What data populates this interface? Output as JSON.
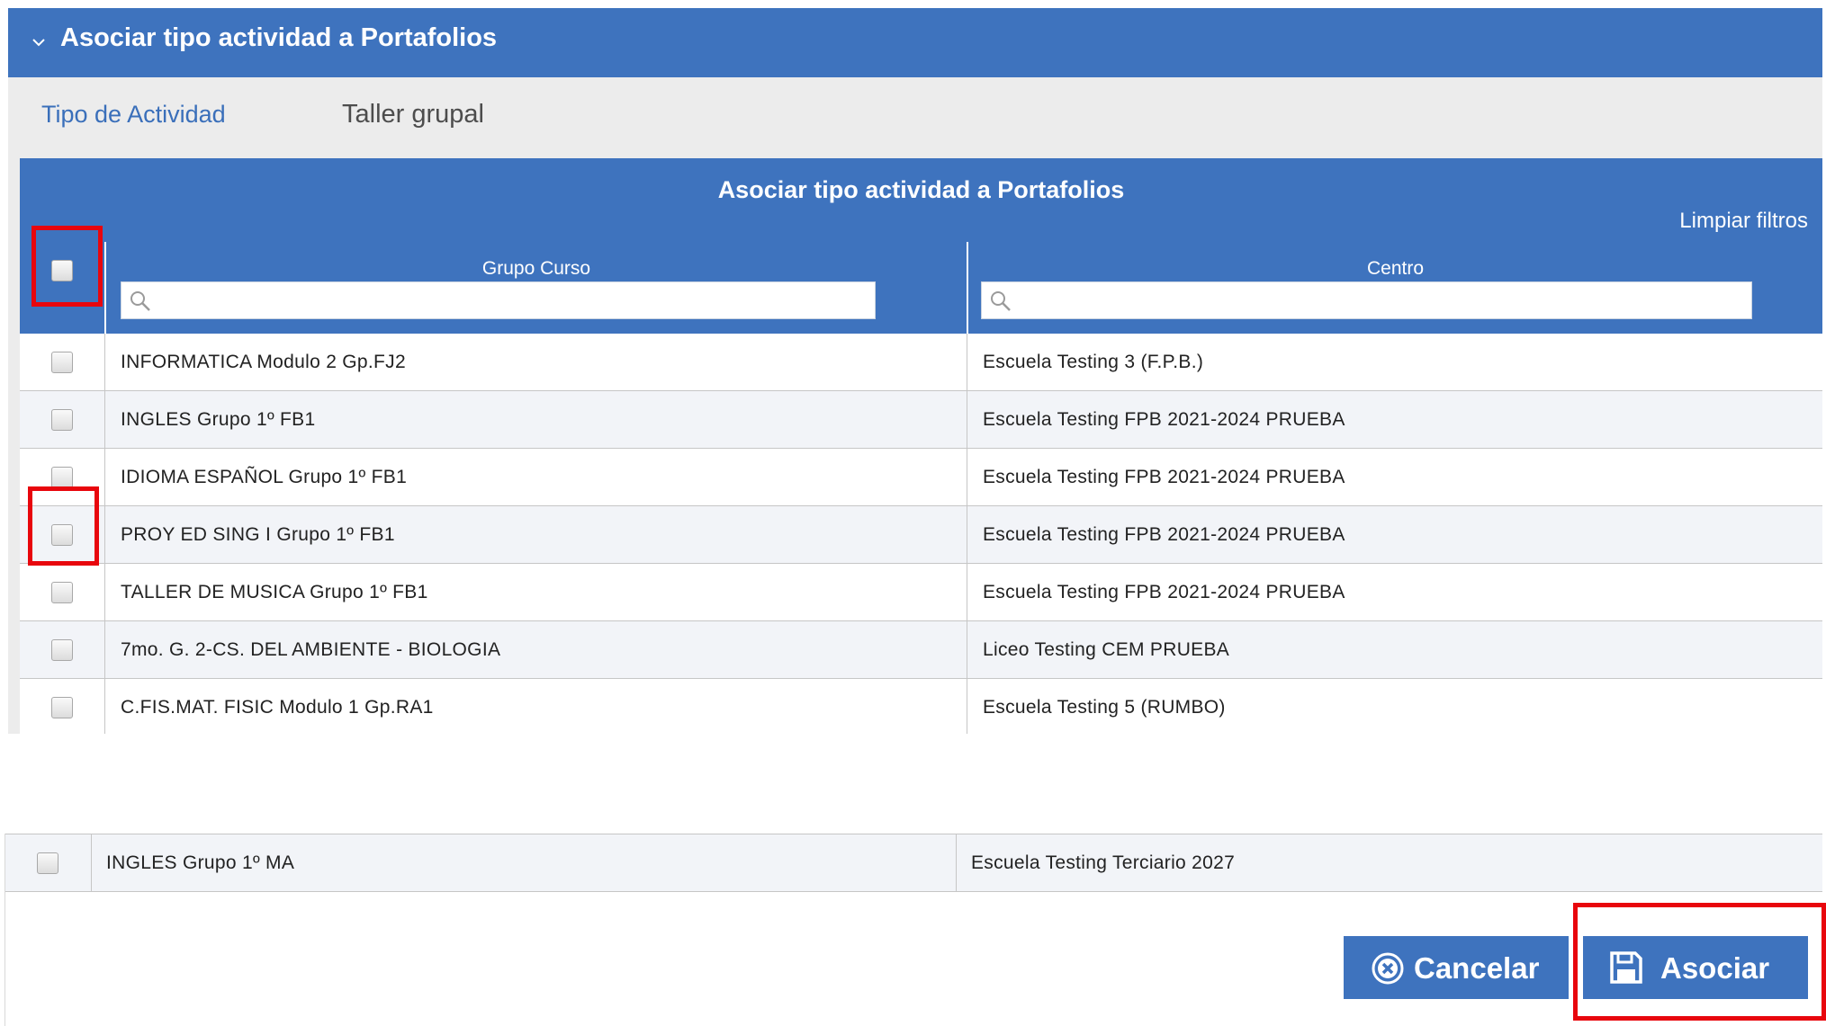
{
  "section": {
    "title": "Asociar tipo actividad a Portafolios"
  },
  "activity": {
    "label": "Tipo de Actividad",
    "value": "Taller grupal"
  },
  "grid": {
    "caption": "Asociar tipo actividad a Portafolios",
    "clear_filters": "Limpiar filtros",
    "columns": {
      "group": "Grupo Curso",
      "center": "Centro"
    },
    "rows": [
      {
        "group": "INFORMATICA Modulo 2 Gp.FJ2",
        "center": "Escuela Testing 3 (F.P.B.)"
      },
      {
        "group": "INGLES Grupo 1º FB1",
        "center": "Escuela Testing FPB 2021-2024 PRUEBA"
      },
      {
        "group": "IDIOMA ESPAÑOL Grupo 1º FB1",
        "center": "Escuela Testing FPB 2021-2024 PRUEBA"
      },
      {
        "group": "PROY ED SING I Grupo 1º FB1",
        "center": "Escuela Testing FPB 2021-2024 PRUEBA"
      },
      {
        "group": "TALLER DE MUSICA Grupo 1º FB1",
        "center": "Escuela Testing FPB 2021-2024 PRUEBA"
      },
      {
        "group": "7mo. G. 2-CS. DEL AMBIENTE - BIOLOGIA",
        "center": "Liceo Testing CEM PRUEBA"
      },
      {
        "group": "C.FIS.MAT. FISIC Modulo 1 Gp.RA1",
        "center": "Escuela Testing 5 (RUMBO)"
      }
    ],
    "extra_row": {
      "group": "INGLES Grupo 1º MA",
      "center": "Escuela Testing Terciario 2027"
    }
  },
  "actions": {
    "cancel": "Cancelar",
    "submit": "Asociar"
  },
  "colors": {
    "header_blue": "#3e73be",
    "highlight_red": "#e8060d",
    "panel_grey": "#ececec"
  }
}
